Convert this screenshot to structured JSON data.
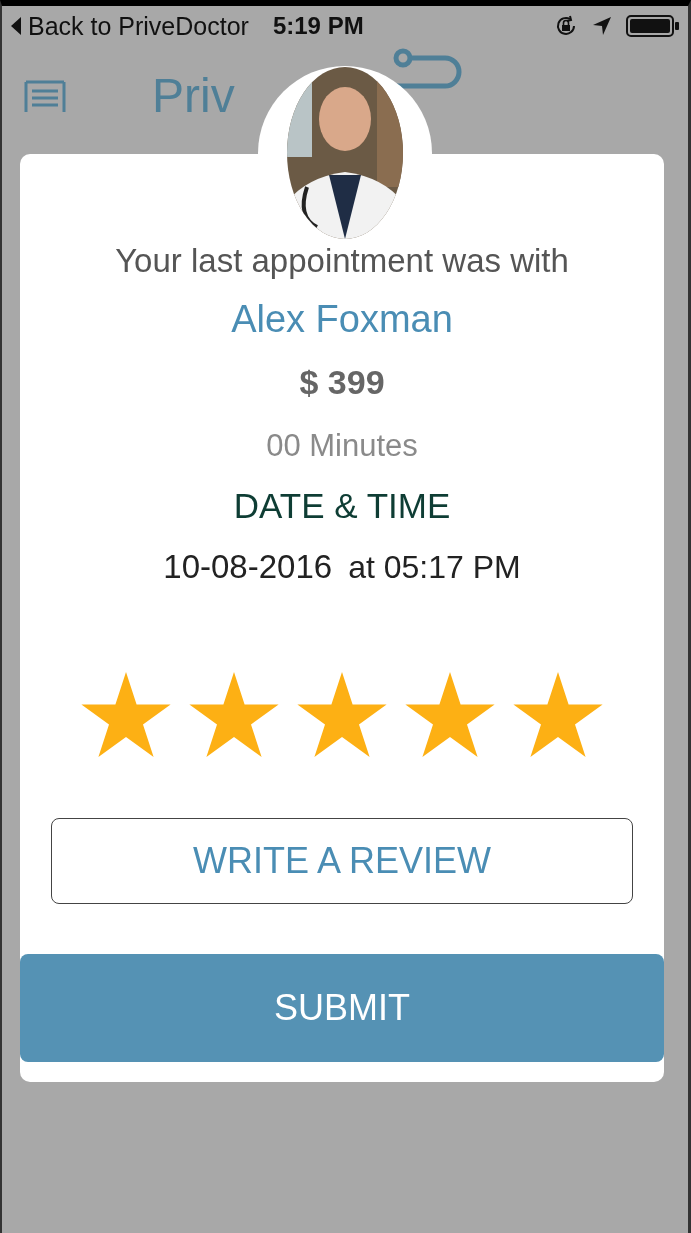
{
  "status_bar": {
    "back": "Back to PriveDoctor",
    "time": "5:19 PM"
  },
  "header": {
    "logo": "Priv"
  },
  "appointment": {
    "intro": "Your last appointment was with",
    "doctor": "Alex Foxman",
    "price": "$ 399",
    "duration": "00 Minutes",
    "date_heading": "DATE & TIME",
    "date": "10-08-2016",
    "time": "at 05:17 PM"
  },
  "rating": {
    "stars": 5
  },
  "buttons": {
    "review": "WRITE A REVIEW",
    "submit": "SUBMIT"
  }
}
